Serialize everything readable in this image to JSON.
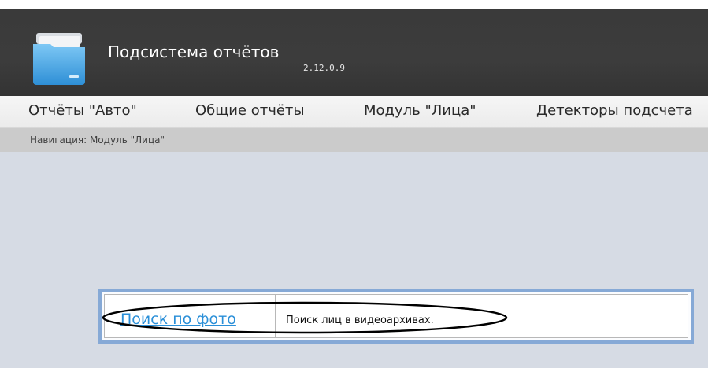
{
  "header": {
    "title": "Подсистема отчётов",
    "version": "2.12.0.9",
    "logo_icon": "folder-icon"
  },
  "menu": {
    "items": [
      {
        "label": "Отчёты \"Авто\""
      },
      {
        "label": "Общие отчёты"
      },
      {
        "label": "Модуль \"Лица\""
      },
      {
        "label": "Детекторы подсчета"
      }
    ]
  },
  "breadcrumb": {
    "text": "Навигация: Модуль \"Лица\""
  },
  "reports": [
    {
      "link_label": "Поиск по фото",
      "description": "Поиск лиц в видеоархивах."
    }
  ],
  "colors": {
    "header_bg": "#3a3a3a",
    "menu_bg": "#efefef",
    "breadcrumb_bg": "#cbcbcb",
    "content_bg": "#d6dbe4",
    "table_border": "#86a9d6",
    "link": "#2a8fd8"
  }
}
